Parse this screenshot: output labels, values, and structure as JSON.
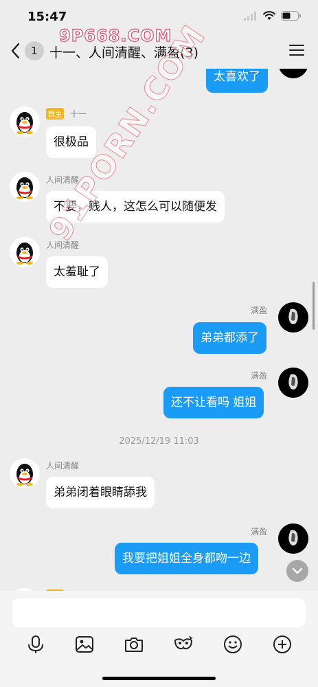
{
  "status": {
    "time": "15:47"
  },
  "nav": {
    "unread_count": "1",
    "title": "十一、人间清醒、满盈(3)"
  },
  "watermark": {
    "top": "9P668.COM",
    "diagonal": "91PORN.COM"
  },
  "messages": [
    {
      "side": "out",
      "text": "太喜欢了"
    },
    {
      "side": "in",
      "sender": "十一",
      "badge": "群主",
      "text": "很极品"
    },
    {
      "side": "in",
      "sender": "人间清醒",
      "text": "不要，贱人，这怎么可以随便发"
    },
    {
      "side": "in",
      "sender": "人间清醒",
      "text": "太羞耻了"
    },
    {
      "side": "out",
      "sender": "满盈",
      "text": "弟弟都添了"
    },
    {
      "side": "out",
      "sender": "满盈",
      "text": "还不让看吗 姐姐"
    },
    {
      "type": "timestamp",
      "text": "2025/12/19 11:03"
    },
    {
      "side": "in",
      "sender": "人间清醒",
      "text": "弟弟闭着眼睛舔我"
    },
    {
      "side": "out",
      "sender": "满盈",
      "text": "我要把姐姐全身都吻一边"
    },
    {
      "side": "in",
      "badge": "群主",
      "sender": "十一",
      "partial": true
    }
  ],
  "input": {
    "placeholder": ""
  },
  "toolbar": [
    "microphone-icon",
    "image-icon",
    "camera-icon",
    "emoji-mask-icon",
    "smiley-icon",
    "plus-icon"
  ],
  "colors": {
    "accent": "#1a9bf5",
    "background": "#ededed",
    "badge": "#f5b625"
  }
}
